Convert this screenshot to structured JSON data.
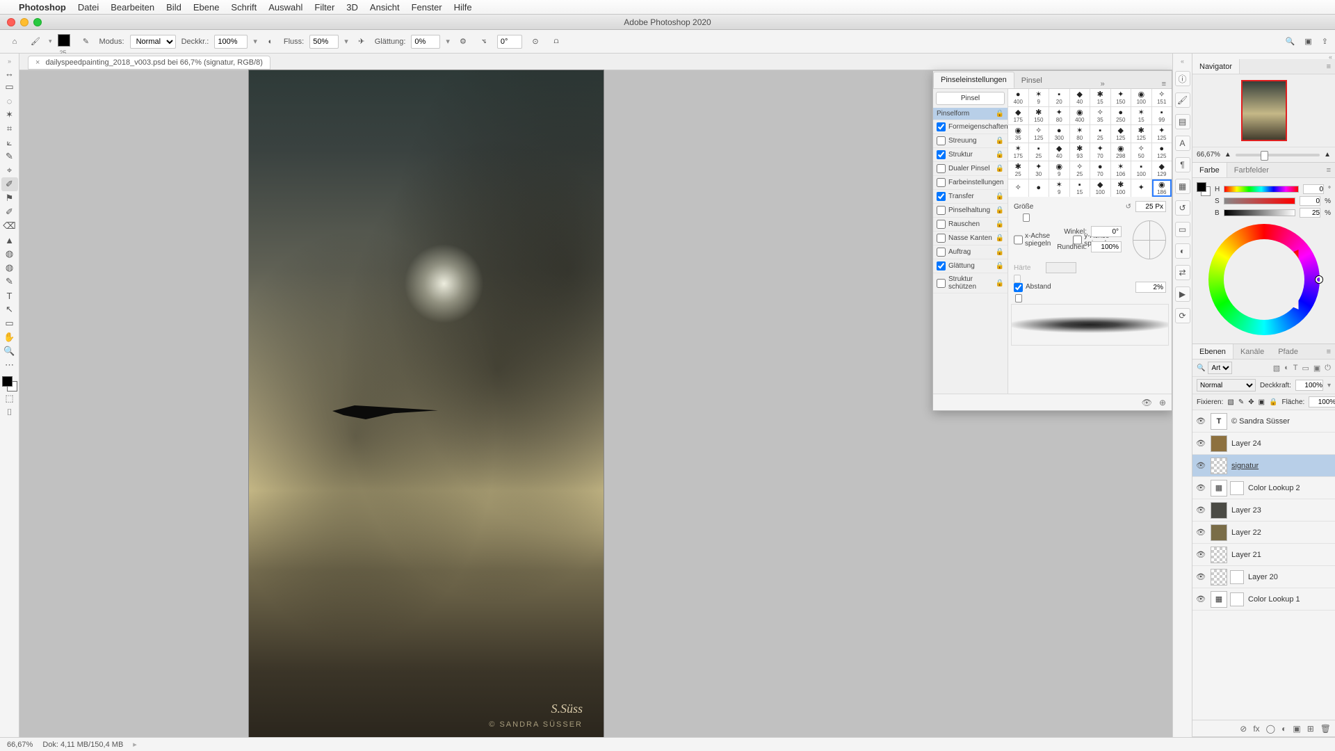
{
  "menubar": {
    "apple": "",
    "app": "Photoshop",
    "items": [
      "Datei",
      "Bearbeiten",
      "Bild",
      "Ebene",
      "Schrift",
      "Auswahl",
      "Filter",
      "3D",
      "Ansicht",
      "Fenster",
      "Hilfe"
    ]
  },
  "window": {
    "title": "Adobe Photoshop 2020"
  },
  "docTab": {
    "label": "dailyspeedpainting_2018_v003.psd bei 66,7% (signatur, RGB/8)",
    "close": "×"
  },
  "options": {
    "fgSizeLabel": "25",
    "modusLabel": "Modus:",
    "modus": "Normal",
    "opacLabel": "Deckkr.:",
    "opac": "100%",
    "flowLabel": "Fluss:",
    "flow": "50%",
    "smoothLabel": "Glättung:",
    "smooth": "0%",
    "rotLabel": "⦪",
    "rot": "0°"
  },
  "tools": [
    "↔",
    "▭",
    "◌",
    "✶",
    "⌗",
    "⟀",
    "✎",
    "⌖",
    "✐",
    "⚑",
    "⌫",
    "▲",
    "◍",
    "T",
    "↖",
    "✥",
    "✋",
    "🔍",
    "⋯",
    "⬚",
    "⬛",
    "⌷",
    "⬯"
  ],
  "brushPanel": {
    "tabs": {
      "settings": "Pinseleinstellungen",
      "brushes": "Pinsel"
    },
    "btnBrushes": "Pinsel",
    "sections": [
      {
        "k": "Pinselform",
        "sel": true,
        "chk": null
      },
      {
        "k": "Formeigenschaften",
        "chk": true
      },
      {
        "k": "Streuung",
        "chk": false
      },
      {
        "k": "Struktur",
        "chk": true
      },
      {
        "k": "Dualer Pinsel",
        "chk": false
      },
      {
        "k": "Farbeinstellungen",
        "chk": false
      },
      {
        "k": "Transfer",
        "chk": true
      },
      {
        "k": "Pinselhaltung",
        "chk": false
      },
      {
        "k": "Rauschen",
        "chk": false
      },
      {
        "k": "Nasse Kanten",
        "chk": false
      },
      {
        "k": "Auftrag",
        "chk": false
      },
      {
        "k": "Glättung",
        "chk": true
      },
      {
        "k": "Struktur schützen",
        "chk": false
      }
    ],
    "thumbs": [
      [
        "400",
        "9",
        "20",
        "40",
        "15",
        "150",
        "100",
        "151"
      ],
      [
        "175",
        "150",
        "80",
        "400",
        "35",
        "250",
        "15",
        "99"
      ],
      [
        "35",
        "125",
        "300",
        "80",
        "25",
        "125",
        "125",
        "125"
      ],
      [
        "175",
        "25",
        "40",
        "93",
        "70",
        "298",
        "50",
        "125"
      ],
      [
        "25",
        "30",
        "9",
        "25",
        "70",
        "106",
        "100",
        "129"
      ],
      [
        "",
        "",
        "9",
        "15",
        "100",
        "100",
        "",
        "186"
      ]
    ],
    "selThumb": [
      5,
      7
    ],
    "sizeLabel": "Größe",
    "sizeVal": "25 Px",
    "flipX": "x-Achse spiegeln",
    "flipY": "y-Achse spiegeln",
    "angleLabel": "Winkel:",
    "angleVal": "0°",
    "roundLabel": "Rundheit:",
    "roundVal": "100%",
    "hardLabel": "Härte",
    "spaceLabel": "Abstand",
    "spaceVal": "2%"
  },
  "navigator": {
    "tab": "Navigator",
    "zoom": "66,67%"
  },
  "colorPanel": {
    "tabs": {
      "farbe": "Farbe",
      "felder": "Farbfelder"
    },
    "H": "0",
    "S": "0",
    "B": "25",
    "pct": "%"
  },
  "layersPanel": {
    "tabs": {
      "ebenen": "Ebenen",
      "kanale": "Kanäle",
      "pfade": "Pfade"
    },
    "filter": "Art",
    "blend": "Normal",
    "opacLbl": "Deckkraft:",
    "opac": "100%",
    "lockLbl": "Fixieren:",
    "fillLbl": "Fläche:",
    "fill": "100%",
    "rows": [
      {
        "vis": true,
        "type": "T",
        "name": "© Sandra Süsser"
      },
      {
        "vis": true,
        "type": "img",
        "name": "Layer 24",
        "thumb": "#8d713f"
      },
      {
        "vis": true,
        "type": "checker",
        "name": "signatur",
        "sel": true,
        "und": true
      },
      {
        "vis": true,
        "type": "adj",
        "name": "Color Lookup 2",
        "mask": true
      },
      {
        "vis": true,
        "type": "img",
        "name": "Layer 23",
        "thumb": "#4b4b45"
      },
      {
        "vis": true,
        "type": "img",
        "name": "Layer 22",
        "thumb": "#7a6d48"
      },
      {
        "vis": true,
        "type": "checker",
        "name": "Layer 21"
      },
      {
        "vis": true,
        "type": "checker",
        "name": "Layer 20",
        "mask": true
      },
      {
        "vis": true,
        "type": "adj",
        "name": "Color Lookup 1",
        "mask": true
      }
    ]
  },
  "status": {
    "zoom": "66,67%",
    "doc": "Dok: 4,11 MB/150,4 MB"
  },
  "artwork": {
    "signature": "S.Süss",
    "copyright": "© SANDRA SÜSSER"
  }
}
